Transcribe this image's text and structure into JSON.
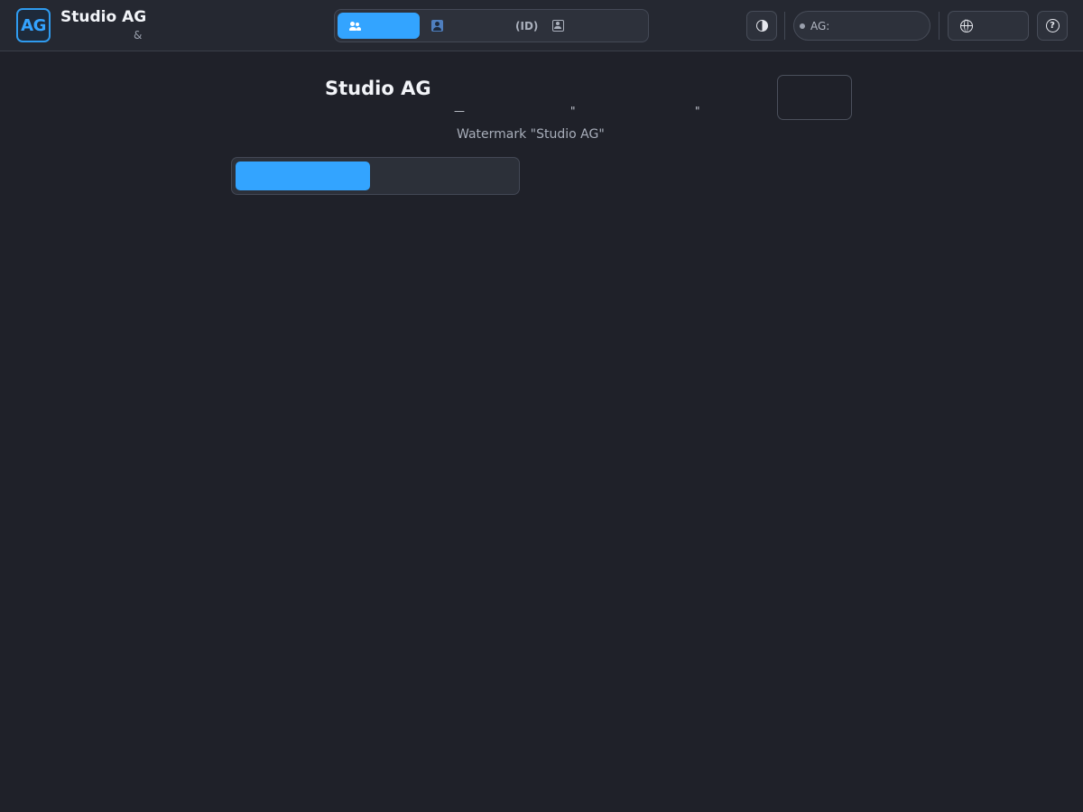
{
  "header": {
    "logo_text": "AG",
    "app_title": "Studio AG",
    "app_subtitle": "&",
    "mode_tabs": [
      {
        "label": "",
        "icon": "users-icon",
        "active": true
      },
      {
        "label": "(ID)",
        "icon": "profile-card-icon",
        "active": false
      },
      {
        "label": "",
        "icon": "profile-outline-icon",
        "active": false
      }
    ],
    "status_text": "AG:",
    "contrast_icon": "contrast-icon",
    "language_icon": "globe-icon",
    "help_icon": "help-icon",
    "help_glyph": "?"
  },
  "main": {
    "title": "Studio AG",
    "description_dash": "—",
    "description_quote_open": "\"",
    "description_quote_close": "\"",
    "watermark_label": "Watermark \"Studio AG\"",
    "progress": 0.48
  },
  "colors": {
    "accent": "#33a4ff",
    "background": "#1f2129",
    "topbar": "#252831"
  }
}
